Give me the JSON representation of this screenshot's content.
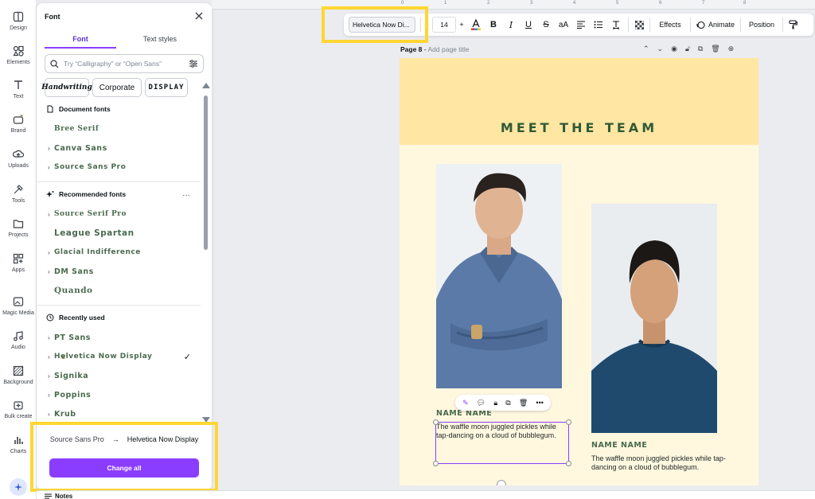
{
  "rail": {
    "items": [
      {
        "label": "Design",
        "icon": "design-icon"
      },
      {
        "label": "Elements",
        "icon": "elements-icon"
      },
      {
        "label": "Text",
        "icon": "text-icon"
      },
      {
        "label": "Brand",
        "icon": "brand-icon"
      },
      {
        "label": "Uploads",
        "icon": "uploads-icon"
      },
      {
        "label": "Tools",
        "icon": "tools-icon"
      },
      {
        "label": "Projects",
        "icon": "projects-icon"
      },
      {
        "label": "Apps",
        "icon": "apps-icon"
      },
      {
        "label": "Magic Media",
        "icon": "magic-media-icon"
      },
      {
        "label": "Audio",
        "icon": "audio-icon"
      },
      {
        "label": "Background",
        "icon": "background-icon"
      },
      {
        "label": "Bulk create",
        "icon": "bulk-create-icon"
      },
      {
        "label": "Charts",
        "icon": "charts-icon"
      }
    ]
  },
  "panel": {
    "title": "Font",
    "tabs": [
      "Font",
      "Text styles"
    ],
    "search_placeholder": "Try “Calligraphy” or “Open Sans”",
    "chips": [
      "Handwriting",
      "Corporate",
      "DISPLAY"
    ],
    "sections": {
      "document": {
        "title": "Document fonts",
        "fonts": [
          {
            "name": "Bree Serif",
            "expandable": false
          },
          {
            "name": "Canva Sans",
            "expandable": true
          },
          {
            "name": "Source Sans Pro",
            "expandable": true
          }
        ]
      },
      "recommended": {
        "title": "Recommended fonts",
        "more": "…",
        "fonts": [
          {
            "name": "Source Serif Pro",
            "expandable": true
          },
          {
            "name": "League Spartan",
            "expandable": false
          },
          {
            "name": "Glacial Indifference",
            "expandable": true
          },
          {
            "name": "DM Sans",
            "expandable": true
          },
          {
            "name": "Quando",
            "expandable": false
          }
        ]
      },
      "recent": {
        "title": "Recently used",
        "fonts": [
          {
            "name": "PT Sans",
            "expandable": true
          },
          {
            "name": "Helvetica Now Display",
            "expandable": true,
            "crown": true,
            "selected": true
          },
          {
            "name": "Signika",
            "expandable": true
          },
          {
            "name": "Poppins",
            "expandable": true
          },
          {
            "name": "Krub",
            "expandable": true
          }
        ]
      }
    },
    "replace": {
      "from": "Source Sans Pro",
      "arrow": "→",
      "to": "Helvetica Now Display"
    },
    "change_all_label": "Change all"
  },
  "ruler": {
    "ticks": [
      "0",
      "1",
      "2",
      "3",
      "4",
      "5",
      "6",
      "7",
      "8"
    ]
  },
  "toolbar": {
    "font_name": "Helvetica Now Di...",
    "font_size": "14",
    "minus": "−",
    "plus": "+",
    "effects_label": "Effects",
    "animate_label": "Animate",
    "position_label": "Position"
  },
  "page": {
    "label": "Page 8",
    "dash": " - ",
    "add_title": "Add page title"
  },
  "canvas": {
    "title": "MEET THE TEAM",
    "member1": {
      "name": "NAME NAME",
      "bio": "The waffle moon juggled pickles while tap-dancing on a cloud of bubblegum."
    },
    "member2": {
      "name": "NAME NAME",
      "bio": "The waffle moon juggled pickles while tap-dancing on a cloud of bubblegum."
    }
  },
  "bottom": {
    "notes_label": "Notes"
  },
  "colors": {
    "accent": "#8b3dff",
    "highlight": "#ffd633",
    "banner": "#ffe6a3",
    "canvas": "#fff8df",
    "title": "#2f5a35"
  }
}
